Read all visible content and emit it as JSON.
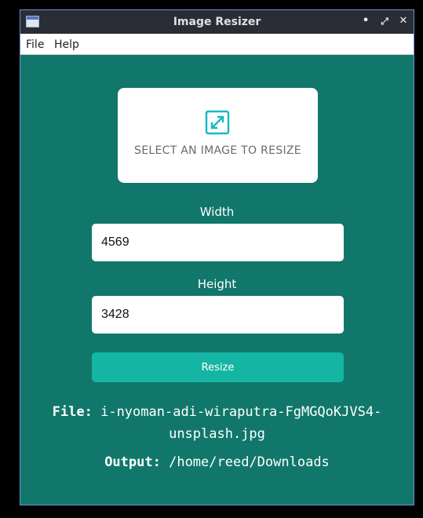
{
  "window": {
    "title": "Image Resizer",
    "controls": {
      "minimize": "•",
      "maximize": "⤢",
      "close": "✕"
    }
  },
  "menu": {
    "file": "File",
    "help": "Help"
  },
  "picker": {
    "label": "SELECT AN IMAGE TO RESIZE",
    "icon": "expand-arrows-icon"
  },
  "width": {
    "label": "Width",
    "value": "4569"
  },
  "height": {
    "label": "Height",
    "value": "3428"
  },
  "resize_button": "Resize",
  "file": {
    "key": "File:",
    "line1": "i-nyoman-adi-wiraputra-FgMGQoKJVS4-",
    "line2": "unsplash.jpg"
  },
  "output": {
    "key": "Output:",
    "path": "/home/reed/Downloads"
  },
  "colors": {
    "background": "#11776b",
    "accent": "#14b5a2",
    "icon": "#17b8c2"
  }
}
